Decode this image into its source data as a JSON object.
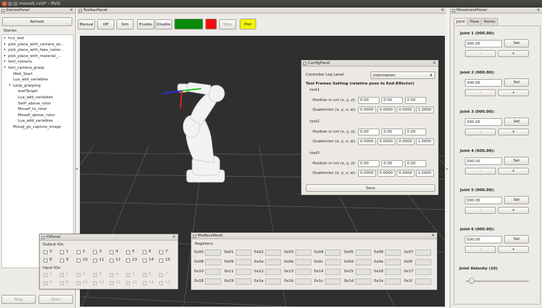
{
  "window": {
    "title": "moveit.rviz* - RViz"
  },
  "stories": {
    "panel_title": "StoriesPanel",
    "refresh_label": "Refresh",
    "tree_label": "Stories",
    "items": [
      {
        "label": "hcx_test",
        "indent": 0,
        "arrow": "▸"
      },
      {
        "label": "pick_place_with_camera_an...",
        "indent": 0,
        "arrow": "▸"
      },
      {
        "label": "pick_place_with_fake_came...",
        "indent": 0,
        "arrow": "▸"
      },
      {
        "label": "pick_place_with_material_...",
        "indent": 0,
        "arrow": "▸"
      },
      {
        "label": "test_camera",
        "indent": 0,
        "arrow": "▸"
      },
      {
        "label": "test_camera_grasp",
        "indent": 0,
        "arrow": "▾"
      },
      {
        "label": "Wait_Start",
        "indent": 1,
        "arrow": ""
      },
      {
        "label": "Lua_add_variables",
        "indent": 1,
        "arrow": ""
      },
      {
        "label": "Loop_grasping",
        "indent": 1,
        "arrow": "▾"
      },
      {
        "label": "waitTarget",
        "indent": 2,
        "arrow": ""
      },
      {
        "label": "Lua_add_variables",
        "indent": 2,
        "arrow": ""
      },
      {
        "label": "SetP_above_rotor",
        "indent": 2,
        "arrow": ""
      },
      {
        "label": "MoveP_to_rotor",
        "indent": 2,
        "arrow": ""
      },
      {
        "label": "MoveP_above_rotor",
        "indent": 2,
        "arrow": ""
      },
      {
        "label": "Lua_add_variables",
        "indent": 2,
        "arrow": ""
      },
      {
        "label": "MoveJ_go_capture_image",
        "indent": 1,
        "arrow": ""
      }
    ],
    "stop_label": "Stop",
    "start_label": "Start"
  },
  "toolbar": {
    "panel_title": "ToolbarPanel",
    "manual": "Manual",
    "off": "Off",
    "sim": "Sim",
    "enable": "Enable",
    "disable": "Disable",
    "stop": "Stop",
    "plot": "Plot",
    "colors": {
      "green": "#0a8a0a",
      "red": "#ee1111",
      "yellow": "#f4f400"
    }
  },
  "config": {
    "panel_title": "ConfigPanel",
    "log_level_label": "Controller Log Level:",
    "log_level_value": "Information",
    "tool_frames_title": "Tool Frames Setting (relative pose to End-Effector)",
    "position_label": "Position in cm (x, y, z):",
    "quaternion_label": "Quaternion (x, y, z, w):",
    "tools": [
      {
        "name": "tool1",
        "position": [
          "0.00",
          "0.00",
          "0.00"
        ],
        "quaternion": [
          "0.0000",
          "0.0000",
          "0.0000",
          "1.0000"
        ]
      },
      {
        "name": "tool2",
        "position": [
          "0.00",
          "0.00",
          "0.00"
        ],
        "quaternion": [
          "0.0000",
          "0.0000",
          "0.0000",
          "1.0000"
        ]
      },
      {
        "name": "tool3",
        "position": [
          "0.00",
          "0.00",
          "0.00"
        ],
        "quaternion": [
          "0.0000",
          "0.0000",
          "0.0000",
          "1.0000"
        ]
      }
    ],
    "save_label": "Save"
  },
  "io": {
    "panel_title": "IOPanel",
    "output_label": "Output IOs:",
    "input_label": "Input IOs:",
    "channels": [
      "0",
      "1",
      "2",
      "3",
      "4",
      "5",
      "6",
      "7",
      "8",
      "9",
      "10",
      "11",
      "12",
      "13",
      "14",
      "15"
    ]
  },
  "modbus": {
    "panel_title": "ModbusPanel",
    "registers_label": "Registers:",
    "registers": [
      "0x00",
      "0x01",
      "0x02",
      "0x03",
      "0x04",
      "0x05",
      "0x06",
      "0x07",
      "0x08",
      "0x09",
      "0x0a",
      "0x0b",
      "0x0c",
      "0x0d",
      "0x0e",
      "0x0f",
      "0x10",
      "0x11",
      "0x12",
      "0x13",
      "0x14",
      "0x15",
      "0x16",
      "0x17",
      "0x18",
      "0x19",
      "0x1a",
      "0x1b",
      "0x1c",
      "0x1d",
      "0x1e",
      "0x1f"
    ]
  },
  "movement": {
    "panel_title": "MovementPanel",
    "tabs": [
      "Joint",
      "Pose",
      "Points"
    ],
    "joints": [
      {
        "label": "Joint 1 (000.00):",
        "value": "000.00"
      },
      {
        "label": "Joint 2 (000.00):",
        "value": "000.00"
      },
      {
        "label": "Joint 3 (000.00):",
        "value": "000.00"
      },
      {
        "label": "Joint 4 (000.00):",
        "value": "000.00"
      },
      {
        "label": "Joint 5 (000.00):",
        "value": "000.00"
      },
      {
        "label": "Joint 6 (000.00):",
        "value": "000.00"
      }
    ],
    "set_label": "Set",
    "minus_label": "-",
    "plus_label": "+",
    "velocity_label": "Joint Velocity (10)",
    "velocity_fraction": 0.1
  }
}
